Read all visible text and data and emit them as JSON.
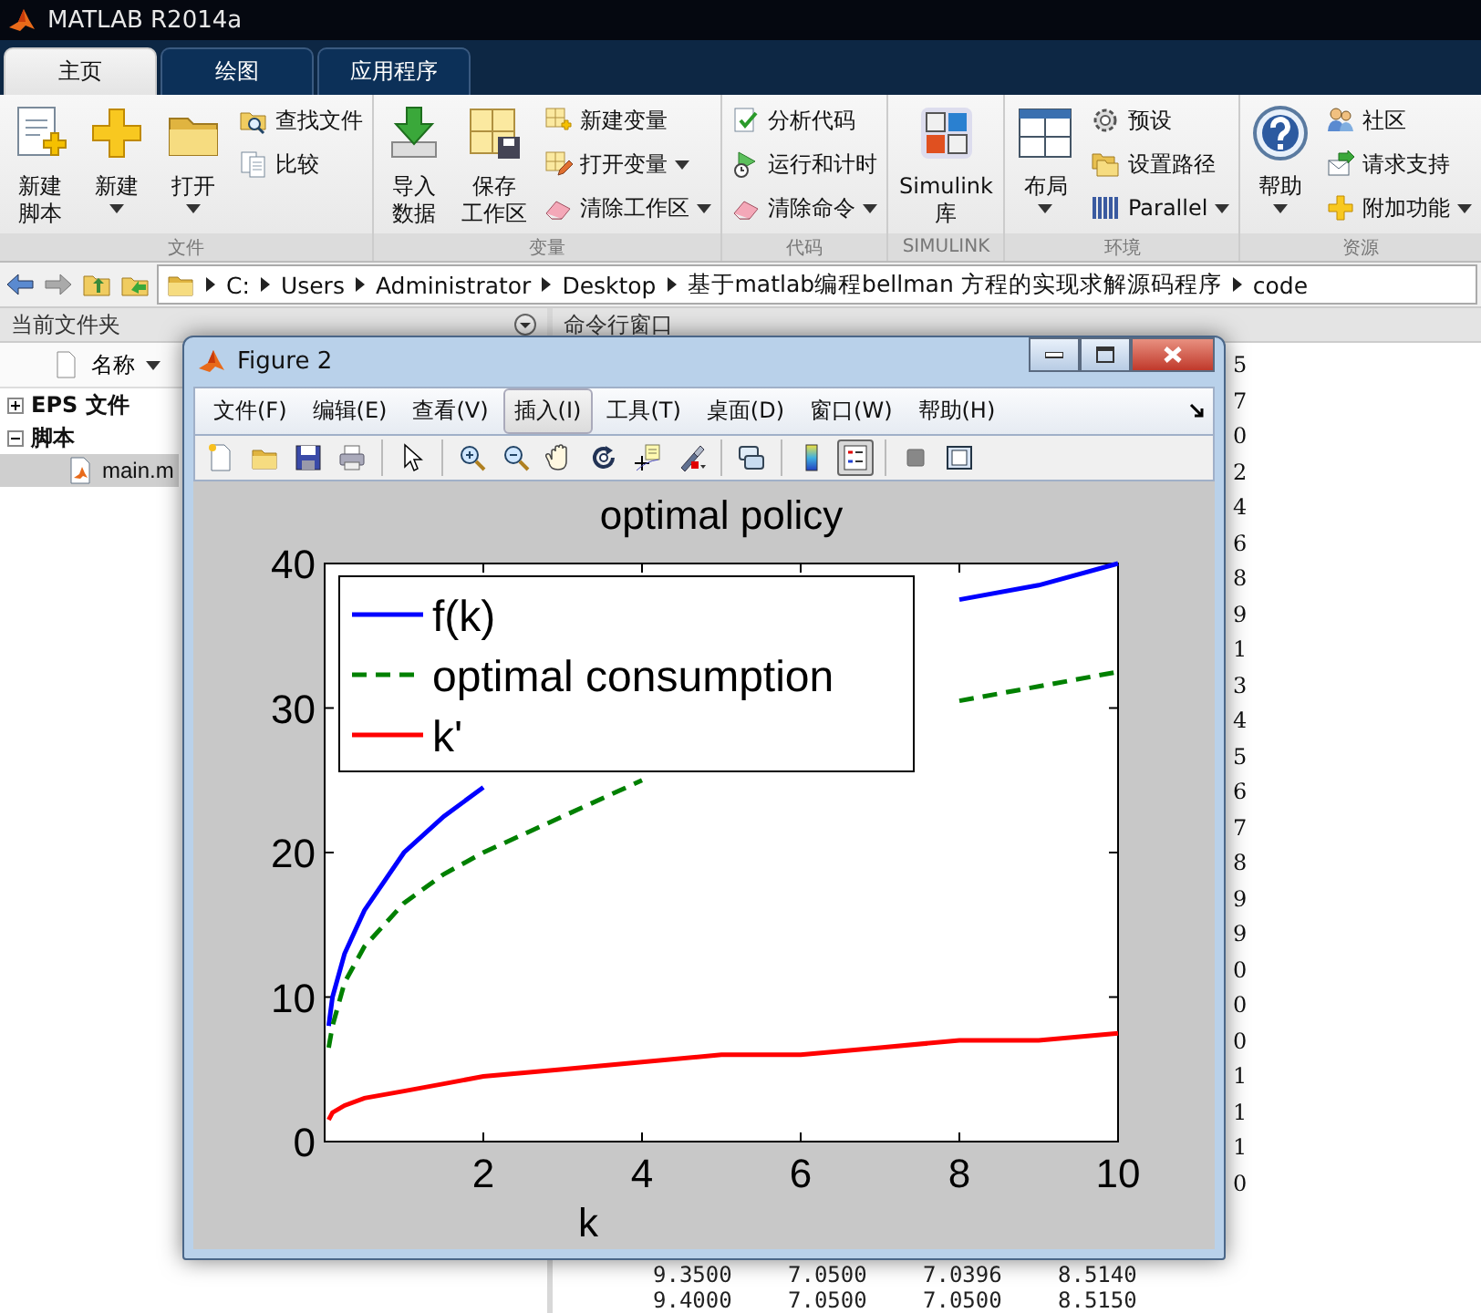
{
  "app": {
    "title": "MATLAB R2014a"
  },
  "ribbon_tabs": [
    {
      "label": "主页",
      "selected": true
    },
    {
      "label": "绘图",
      "selected": false
    },
    {
      "label": "应用程序",
      "selected": false
    }
  ],
  "ribbon_groups": [
    {
      "label": "文件",
      "items": [
        {
          "kind": "large",
          "label": [
            "新建",
            "脚本"
          ],
          "dropdown": false
        },
        {
          "kind": "large",
          "label": [
            "新建"
          ],
          "dropdown": true
        },
        {
          "kind": "large",
          "label": [
            "打开"
          ],
          "dropdown": true
        },
        {
          "kind": "small",
          "label": [
            "查找文件"
          ],
          "dropdown": false
        },
        {
          "kind": "small",
          "label": [
            "比较"
          ],
          "dropdown": false
        }
      ]
    },
    {
      "label": "变量",
      "items": [
        {
          "kind": "large",
          "label": [
            "导入",
            "数据"
          ],
          "dropdown": false
        },
        {
          "kind": "large",
          "label": [
            "保存",
            "工作区"
          ],
          "dropdown": false
        },
        {
          "kind": "small",
          "label": [
            "新建变量"
          ],
          "dropdown": false
        },
        {
          "kind": "small",
          "label": [
            "打开变量"
          ],
          "dropdown": true
        },
        {
          "kind": "small",
          "label": [
            "清除工作区"
          ],
          "dropdown": true
        }
      ]
    },
    {
      "label": "代码",
      "items": [
        {
          "kind": "small",
          "label": [
            "分析代码"
          ],
          "dropdown": false
        },
        {
          "kind": "small",
          "label": [
            "运行和计时"
          ],
          "dropdown": false
        },
        {
          "kind": "small",
          "label": [
            "清除命令"
          ],
          "dropdown": true
        }
      ]
    },
    {
      "label": "SIMULINK",
      "items": [
        {
          "kind": "large",
          "label": [
            "Simulink",
            "库"
          ],
          "dropdown": false
        }
      ]
    },
    {
      "label": "环境",
      "items": [
        {
          "kind": "large",
          "label": [
            "布局"
          ],
          "dropdown": true
        },
        {
          "kind": "small",
          "label": [
            "预设"
          ],
          "dropdown": false
        },
        {
          "kind": "small",
          "label": [
            "设置路径"
          ],
          "dropdown": false
        },
        {
          "kind": "small",
          "label": [
            "Parallel"
          ],
          "dropdown": true
        }
      ]
    },
    {
      "label": "资源",
      "items": [
        {
          "kind": "large",
          "label": [
            "帮助"
          ],
          "dropdown": true
        },
        {
          "kind": "small",
          "label": [
            "社区"
          ],
          "dropdown": false
        },
        {
          "kind": "small",
          "label": [
            "请求支持"
          ],
          "dropdown": false
        },
        {
          "kind": "small",
          "label": [
            "附加功能"
          ],
          "dropdown": true
        }
      ]
    }
  ],
  "address_bar": {
    "path": [
      "C:",
      "Users",
      "Administrator",
      "Desktop",
      "基于matlab编程bellman 方程的实现求解源码程序",
      "code"
    ]
  },
  "current_folder": {
    "title": "当前文件夹",
    "column": "名称",
    "tree": [
      {
        "label": "EPS 文件",
        "expanded": false,
        "selected": false
      },
      {
        "label": "脚本",
        "expanded": true,
        "selected": false,
        "children": [
          {
            "label": "main.m",
            "selected": true
          }
        ]
      }
    ]
  },
  "command_window": {
    "title": "命令行窗口",
    "edge_digits": [
      "5",
      "7",
      "0",
      "2",
      "4",
      "6",
      "8",
      "9",
      "1",
      "3",
      "4",
      "5",
      "6",
      "7",
      "8",
      "9",
      "9",
      "0",
      "0",
      "0",
      "1",
      "1",
      "1",
      "0"
    ],
    "rows": [
      [
        "9.3500",
        "7.0500",
        "7.0396",
        "8.5140"
      ],
      [
        "9.4000",
        "7.0500",
        "7.0500",
        "8.5150"
      ]
    ]
  },
  "figure": {
    "title": "Figure 2",
    "menu": [
      {
        "label": "文件(F)",
        "selected": false
      },
      {
        "label": "编辑(E)",
        "selected": false
      },
      {
        "label": "查看(V)",
        "selected": false
      },
      {
        "label": "插入(I)",
        "selected": true
      },
      {
        "label": "工具(T)",
        "selected": false
      },
      {
        "label": "桌面(D)",
        "selected": false
      },
      {
        "label": "窗口(W)",
        "selected": false
      },
      {
        "label": "帮助(H)",
        "selected": false
      }
    ],
    "toolbar": [
      [
        {
          "pressed": false
        },
        {
          "pressed": false
        },
        {
          "pressed": false
        },
        {
          "pressed": false
        }
      ],
      [
        {
          "pressed": false
        }
      ],
      [
        {
          "pressed": false
        },
        {
          "pressed": false
        },
        {
          "pressed": false
        },
        {
          "pressed": false
        },
        {
          "pressed": false
        },
        {
          "pressed": false
        }
      ],
      [
        {
          "pressed": false
        }
      ],
      [
        {
          "pressed": false
        },
        {
          "pressed": true
        }
      ],
      [
        {
          "pressed": false
        },
        {
          "pressed": false
        }
      ]
    ],
    "chart_data": {
      "type": "line",
      "title": "optimal policy",
      "xlabel": "k",
      "x": [
        0.05,
        0.1,
        0.25,
        0.5,
        1,
        1.5,
        2,
        3,
        4,
        5,
        6,
        7,
        8,
        9,
        10
      ],
      "series": [
        {
          "name": "f(k)",
          "color": "#0000ff",
          "line_style": "solid",
          "values": [
            8,
            10,
            13,
            16,
            20,
            22.5,
            24.5,
            null,
            null,
            null,
            null,
            null,
            37.5,
            38.5,
            40
          ]
        },
        {
          "name": "optimal consumption",
          "color": "#008000",
          "line_style": "dashed",
          "values": [
            6.5,
            8,
            11,
            13.5,
            16.5,
            18.5,
            20,
            22.5,
            25,
            null,
            null,
            null,
            30.5,
            31.5,
            32.5
          ]
        },
        {
          "name": "k'",
          "color": "#ff0000",
          "line_style": "solid",
          "values": [
            1.5,
            2,
            2.5,
            3,
            3.5,
            4,
            4.5,
            5,
            5.5,
            6,
            6,
            6.5,
            7,
            7,
            7.5
          ]
        }
      ],
      "legend": "upper left",
      "xlim": [
        0,
        10
      ],
      "ylim": [
        0,
        40
      ],
      "xticks": [
        2,
        4,
        6,
        8,
        10
      ],
      "yticks": [
        0,
        10,
        20,
        30,
        40
      ]
    }
  }
}
